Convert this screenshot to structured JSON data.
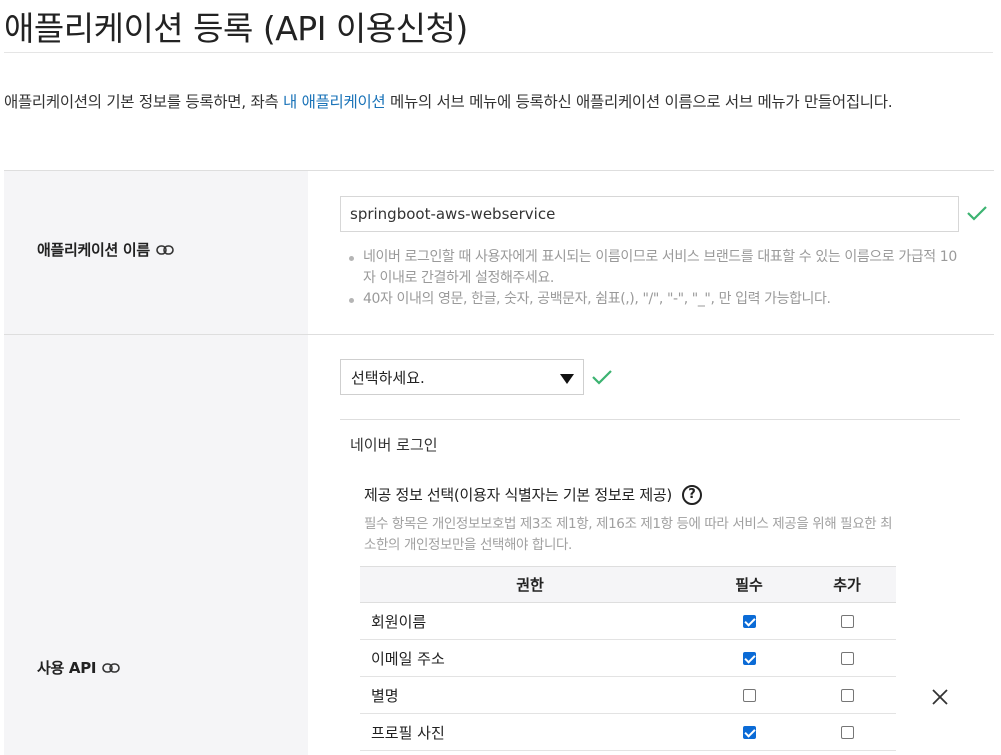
{
  "page": {
    "title": "애플리케이션 등록 (API 이용신청)",
    "intro_before": "애플리케이션의 기본 정보를 등록하면, 좌측 ",
    "intro_link": "내 애플리케이션",
    "intro_after": " 메뉴의 서브 메뉴에 등록하신 애플리케이션 이름으로 서브 메뉴가 만들어집니다."
  },
  "app_name": {
    "label": "애플리케이션 이름",
    "value": "springboot-aws-webservice",
    "hints": [
      "네이버 로그인할 때 사용자에게 표시되는 이름이므로 서비스 브랜드를 대표할 수 있는 이름으로 가급적 10자 이내로 간결하게 설정해주세요.",
      "40자 이내의 영문, 한글, 숫자, 공백문자, 쉼표(,), \"/\", \"-\", \"_\", 만 입력 가능합니다."
    ]
  },
  "api": {
    "label": "사용 API",
    "select_value": "선택하세요.",
    "selected_api": "네이버 로그인",
    "info_title": "제공 정보 선택(이용자 식별자는 기본 정보로 제공)",
    "info_desc": "필수 항목은 개인정보보호법 제3조 제1항, 제16조 제1항 등에 따라 서비스 제공을 위해 필요한 최소한의 개인정보만을 선택해야 합니다.",
    "table_headers": {
      "permission": "권한",
      "required": "필수",
      "additional": "추가"
    },
    "permissions": [
      {
        "name": "회원이름",
        "required": true,
        "additional": false
      },
      {
        "name": "이메일 주소",
        "required": true,
        "additional": false
      },
      {
        "name": "별명",
        "required": false,
        "additional": false
      },
      {
        "name": "프로필 사진",
        "required": true,
        "additional": false
      }
    ]
  },
  "icons": {
    "label_link": "link-icon",
    "valid": "check-icon",
    "help": "help-circle-icon",
    "remove": "close-icon",
    "select_arrow": "caret-down-icon"
  },
  "colors": {
    "link": "#1a73b8",
    "valid_check": "#3cb371",
    "checkbox_checked": "#0b6bd6",
    "label_bg": "#f5f5f7"
  }
}
